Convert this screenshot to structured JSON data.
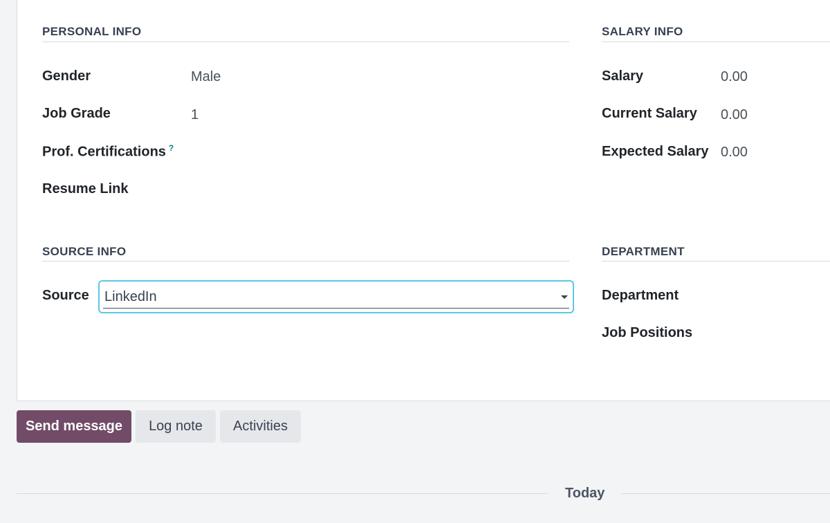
{
  "sections": {
    "personal_info": {
      "title": "PERSONAL INFO",
      "fields": {
        "gender": {
          "label": "Gender",
          "value": "Male"
        },
        "job_grade": {
          "label": "Job Grade",
          "value": "1"
        },
        "certifications": {
          "label": "Prof. Certifications",
          "help": "?"
        },
        "resume_link": {
          "label": "Resume Link"
        }
      }
    },
    "salary_info": {
      "title": "SALARY INFO",
      "fields": {
        "salary": {
          "label": "Salary",
          "value": "0.00"
        },
        "current_salary": {
          "label": "Current Salary",
          "value": "0.00"
        },
        "expected_salary": {
          "label": "Expected Salary",
          "value": "0.00"
        }
      }
    },
    "source_info": {
      "title": "SOURCE INFO",
      "fields": {
        "source": {
          "label": "Source",
          "value": "LinkedIn",
          "icon": "caret-down-icon"
        }
      }
    },
    "department": {
      "title": "DEPARTMENT",
      "fields": {
        "department": {
          "label": "Department"
        },
        "job_positions": {
          "label": "Job Positions"
        }
      }
    }
  },
  "chatter": {
    "send_message": "Send message",
    "log_note": "Log note",
    "activities": "Activities",
    "date_separator": "Today"
  },
  "colors": {
    "primary": "#714b67",
    "focus_border": "#5ac8e6",
    "help_icon": "#017e84"
  }
}
